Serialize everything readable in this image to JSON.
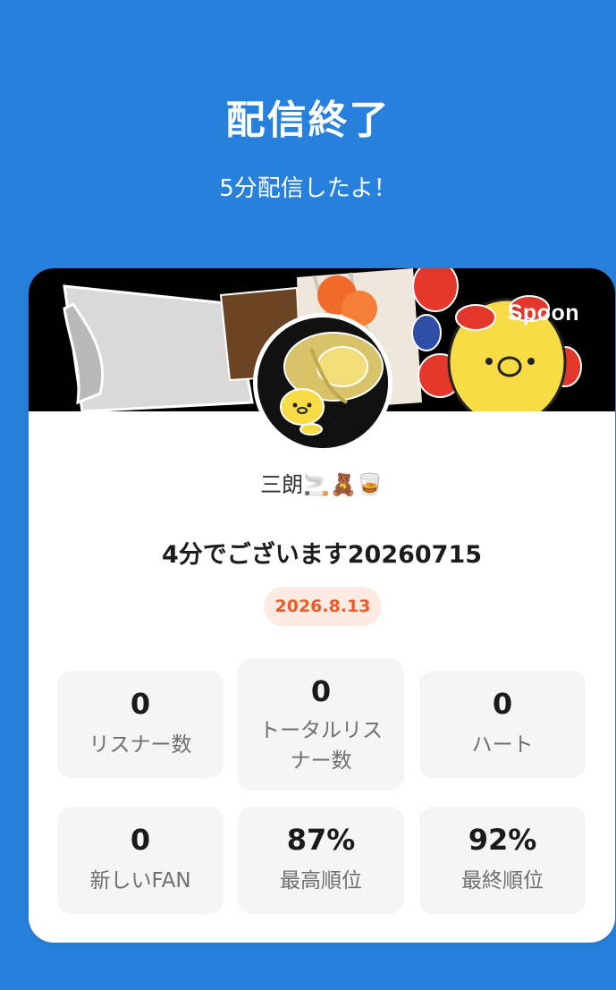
{
  "header": {
    "title": "配信終了",
    "subtitle": "5分配信したよ！"
  },
  "card": {
    "brand": "Spoon",
    "nickname": "三朗🚬🧸🥃",
    "show_title": "4分でございます20260715",
    "date": "2026.8.13",
    "stats": [
      {
        "value": "0",
        "label": "リスナー数"
      },
      {
        "value": "0",
        "label": "トータルリスナー数"
      },
      {
        "value": "0",
        "label": "ハート"
      },
      {
        "value": "0",
        "label": "新しいFAN"
      },
      {
        "value": "87%",
        "label": "最高順位"
      },
      {
        "value": "92%",
        "label": "最終順位"
      }
    ]
  },
  "colors": {
    "background": "#2680DC",
    "card": "#FFFFFF",
    "stat_tile": "#F5F5F5",
    "date_badge_bg": "#FDEAE2",
    "date_badge_text": "#EE5A28"
  }
}
